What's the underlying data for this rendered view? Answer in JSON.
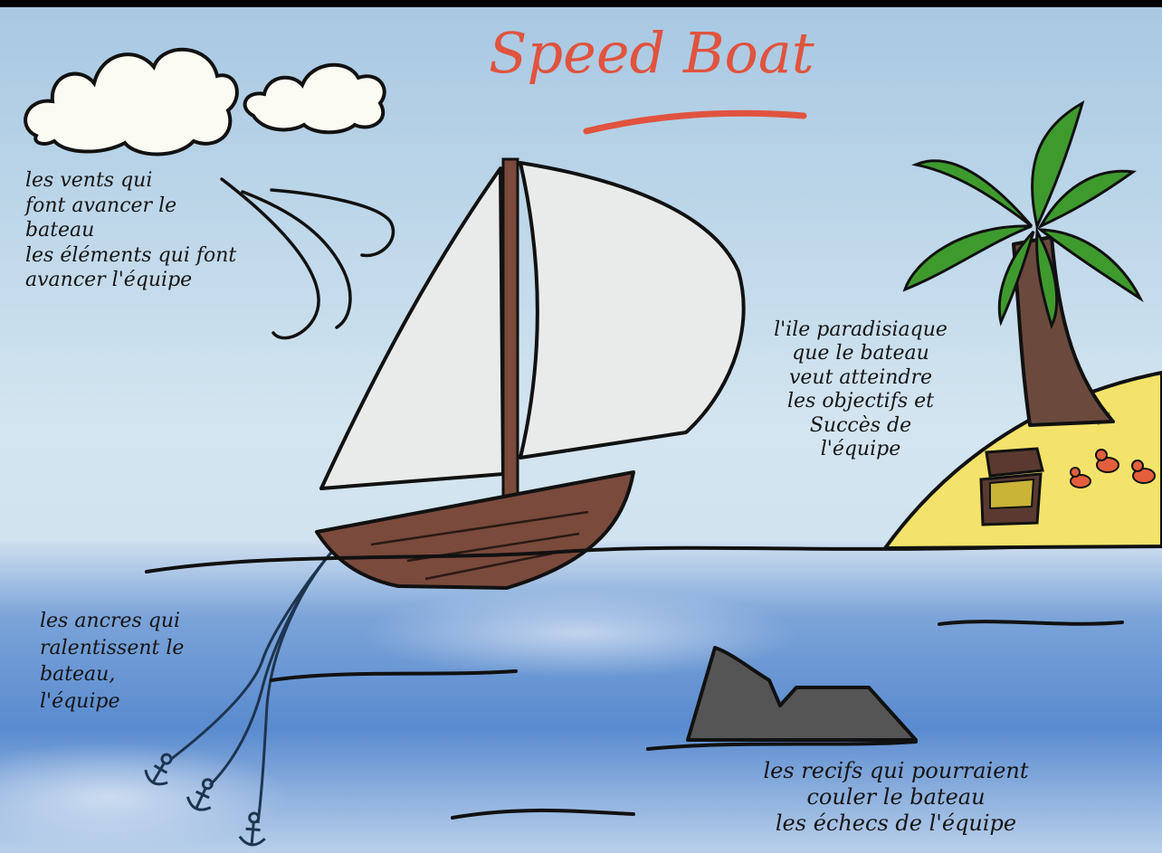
{
  "title": "Speed Boat",
  "notes": {
    "winds": "les vents qui\nfont avancer le\nbateau\nles éléments qui font\navancer l'équipe",
    "island": "l'ile paradisiaque\nque le bateau\nveut atteindre\nles objectifs et\nSuccès de\nl'équipe",
    "anchors": "les ancres qui\nralentissent le\nbateau,\nl'équipe",
    "reefs": "les recifs qui pourraient\ncouler le bateau\nles échecs de l'équipe"
  },
  "colors": {
    "title": "#e0533f",
    "sky": "#cfe3ef",
    "sea": "#5f8fd0",
    "sail": "#e9ebea",
    "hull": "#7a4a3c",
    "palm_leaves": "#3f9a2e",
    "trunk": "#6b4a3d",
    "sand": "#f3e36a",
    "rock": "#555555",
    "treasure": "#c9b437",
    "ducks": "#e35f3c"
  },
  "icons": [
    "cloud-icon",
    "wind-icon",
    "sailboat-icon",
    "anchor-icon",
    "palm-tree-icon",
    "treasure-chest-icon",
    "duck-icon",
    "rock-icon"
  ]
}
